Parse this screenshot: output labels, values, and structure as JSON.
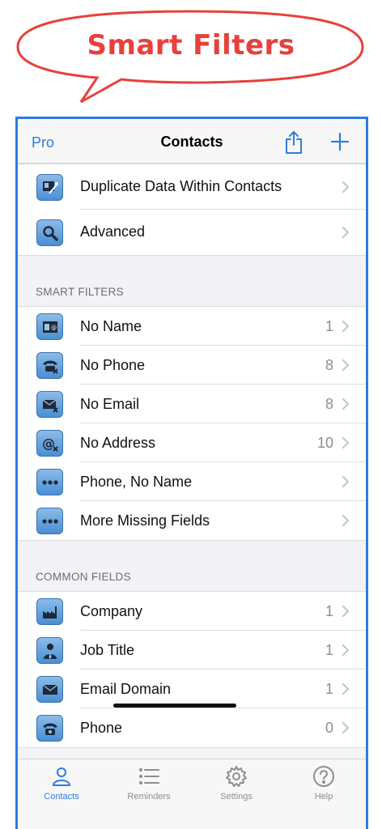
{
  "banner": {
    "title": "Smart Filters"
  },
  "navbar": {
    "left": "Pro",
    "title": "Contacts"
  },
  "top_items": [
    {
      "label": "Duplicate Data Within Contacts",
      "icon": "duplicate-icon"
    },
    {
      "label": "Advanced",
      "icon": "magnifier-icon"
    }
  ],
  "smart_filters": {
    "header": "SMART FILTERS",
    "items": [
      {
        "label": "No Name",
        "count": "1",
        "icon": "card-icon"
      },
      {
        "label": "No Phone",
        "count": "8",
        "icon": "phone-x-icon"
      },
      {
        "label": "No Email",
        "count": "8",
        "icon": "envelope-x-icon"
      },
      {
        "label": "No Address",
        "count": "10",
        "icon": "at-x-icon"
      },
      {
        "label": "Phone, No Name",
        "count": "",
        "icon": "ellipsis-icon"
      },
      {
        "label": "More Missing Fields",
        "count": "",
        "icon": "ellipsis-icon"
      }
    ]
  },
  "common_fields": {
    "header": "COMMON FIELDS",
    "items": [
      {
        "label": "Company",
        "count": "1",
        "icon": "factory-icon"
      },
      {
        "label": "Job Title",
        "count": "1",
        "icon": "person-icon"
      },
      {
        "label": "Email Domain",
        "count": "1",
        "icon": "envelope-icon"
      },
      {
        "label": "Phone",
        "count": "0",
        "icon": "phone-icon"
      }
    ]
  },
  "tabs": [
    {
      "label": "Contacts",
      "icon": "person-tab-icon",
      "active": true
    },
    {
      "label": "Reminders",
      "icon": "list-icon",
      "active": false
    },
    {
      "label": "Settings",
      "icon": "gear-icon",
      "active": false
    },
    {
      "label": "Help",
      "icon": "help-icon",
      "active": false
    }
  ],
  "colors": {
    "accent": "#2f7be0",
    "banner": "#e8403a",
    "frame": "#2a7de1"
  }
}
